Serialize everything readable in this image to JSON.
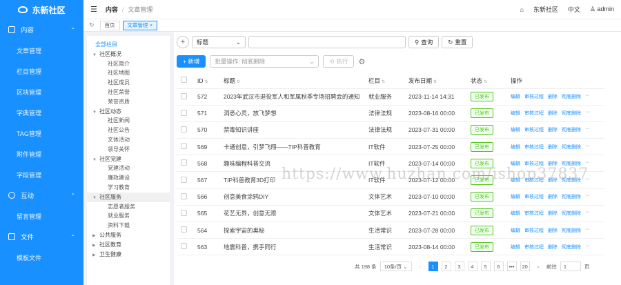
{
  "brand": {
    "name": "东新社区"
  },
  "sidebar": {
    "groups": [
      {
        "label": "内容",
        "icon": "document-icon",
        "items": [
          "文章管理",
          "栏目管理",
          "区块管理",
          "字典管理",
          "TAG管理",
          "附件管理",
          "字段管理"
        ]
      },
      {
        "label": "互动",
        "icon": "chat-icon",
        "items": [
          "留言管理"
        ]
      },
      {
        "label": "文件",
        "icon": "folder-icon",
        "items": [
          "模板文件"
        ]
      }
    ]
  },
  "header": {
    "breadcrumb_root": "内容",
    "breadcrumb_current": "文章管理",
    "site_name": "东新社区",
    "language": "中文",
    "user": "admin"
  },
  "tabs": [
    {
      "label": "首页"
    },
    {
      "label": "文章管理 ×"
    }
  ],
  "tree": {
    "root": "全部栏目",
    "nodes": [
      {
        "label": "社区概况",
        "level": 1,
        "caret": "▼"
      },
      {
        "label": "社区简介",
        "level": 2
      },
      {
        "label": "社区地图",
        "level": 2
      },
      {
        "label": "社区成员",
        "level": 2
      },
      {
        "label": "社区荣誉",
        "level": 2
      },
      {
        "label": "荣誉资质",
        "level": 2
      },
      {
        "label": "社区动态",
        "level": 1,
        "caret": "▼"
      },
      {
        "label": "社区新闻",
        "level": 2
      },
      {
        "label": "社区公告",
        "level": 2
      },
      {
        "label": "文体活动",
        "level": 2
      },
      {
        "label": "领导关怀",
        "level": 2
      },
      {
        "label": "社区党建",
        "level": 1,
        "caret": "▼"
      },
      {
        "label": "党建活动",
        "level": 2
      },
      {
        "label": "廉政建设",
        "level": 2
      },
      {
        "label": "学习教育",
        "level": 2
      },
      {
        "label": "社区服务",
        "level": 1,
        "caret": "▼",
        "selected": true
      },
      {
        "label": "志愿者服务",
        "level": 2
      },
      {
        "label": "就业服务",
        "level": 2
      },
      {
        "label": "资料下载",
        "level": 2
      },
      {
        "label": "公共服务",
        "level": 1,
        "caret": "▶"
      },
      {
        "label": "社区教育",
        "level": 1,
        "caret": "▶"
      },
      {
        "label": "卫生健康",
        "level": 1,
        "caret": "▶"
      }
    ]
  },
  "search": {
    "field_select": "标题",
    "input_value": "",
    "query_label": "查询",
    "reset_label": "重置"
  },
  "actions": {
    "add_label": "+ 新增",
    "batch_select": "批量操作: 彻底删除",
    "execute_label": "执行"
  },
  "table": {
    "headers": [
      "ID",
      "标题",
      "栏目",
      "发布日期",
      "状态",
      "操作"
    ],
    "ops": [
      "编辑",
      "审核过程",
      "删除",
      "彻底删除",
      "···"
    ],
    "rows": [
      {
        "id": "572",
        "title": "2023年武汉市退役军人和军属秋季专场招聘会的通知",
        "column": "就业服务",
        "date": "2023-11-14 14:31",
        "status": "已发布"
      },
      {
        "id": "571",
        "title": "洞悉心灵，放飞梦想",
        "column": "法律法规",
        "date": "2023-08-16 00:00",
        "status": "已发布"
      },
      {
        "id": "570",
        "title": "禁毒知识讲座",
        "column": "法律法规",
        "date": "2023-07-31 00:00",
        "status": "已发布"
      },
      {
        "id": "569",
        "title": "卡通创意，引梦飞翔——TIP科普教育",
        "column": "IT软件",
        "date": "2023-07-25 00:00",
        "status": "已发布"
      },
      {
        "id": "568",
        "title": "趣味编程科普交流",
        "column": "IT软件",
        "date": "2023-07-14 00:00",
        "status": "已发布"
      },
      {
        "id": "567",
        "title": "TIP科普教育3D打印",
        "column": "IT软件",
        "date": "2023-07-12 00:00",
        "status": "已发布"
      },
      {
        "id": "566",
        "title": "创意美食涂鸦DIY",
        "column": "文体艺术",
        "date": "2023-07-10 00:00",
        "status": "已发布"
      },
      {
        "id": "565",
        "title": "花艺无界，创意无限",
        "column": "文体艺术",
        "date": "2023-07-21 00:00",
        "status": "已发布"
      },
      {
        "id": "564",
        "title": "探索宇宙的奥秘",
        "column": "生活常识",
        "date": "2023-07-28 00:00",
        "status": "已发布"
      },
      {
        "id": "563",
        "title": "地震科普，携手同行",
        "column": "生活常识",
        "date": "2023-08-14 00:00",
        "status": "已发布"
      }
    ]
  },
  "pager": {
    "total": "共 198 条",
    "page_size": "10条/页",
    "pages": [
      "1",
      "2",
      "3",
      "4",
      "5",
      "6",
      "•••",
      "20"
    ],
    "current_page": "1",
    "goto_label": "前往",
    "goto_value": "1",
    "page_unit": "页"
  },
  "watermark": "https://www.huzhan.com/ishop37837",
  "colors": {
    "primary": "#1890ff",
    "success": "#52c41a"
  }
}
